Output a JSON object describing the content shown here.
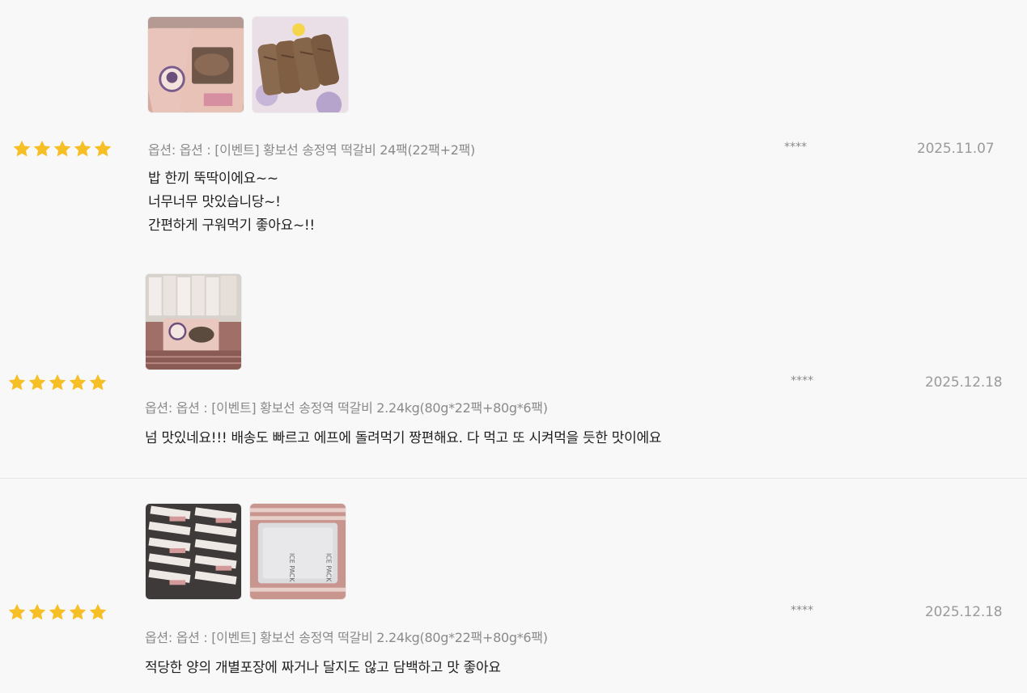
{
  "colors": {
    "star": "#f7bf26",
    "background": "#f8f8f8"
  },
  "reviews": [
    {
      "rating": 5,
      "user": "****",
      "date": "2025.11.07",
      "option": "옵션: 옵션 : [이벤트] 황보선 송정역 떡갈비 24팩(22팩+2팩)",
      "body_lines": [
        "밥 한끼 뚝딱이에요~~",
        "너무너무 맛있습니당~!",
        "간편하게 구워먹기 좋아요~!!"
      ],
      "photos": [
        "package-photo",
        "grilled-galbi-photo"
      ]
    },
    {
      "rating": 5,
      "user": "****",
      "date": "2025.12.18",
      "option": "옵션: 옵션 : [이벤트] 황보선 송정역 떡갈비 2.24kg(80g*22팩+80g*6팩)",
      "body_lines": [
        "넘 맛있네요!!! 배송도 빠르고 에프에 돌려먹기 짱편해요. 다 먹고 또 시켜먹을 듯한 맛이에요"
      ],
      "photos": [
        "box-contents-photo"
      ]
    },
    {
      "rating": 5,
      "user": "****",
      "date": "2025.12.18",
      "option": "옵션: 옵션 : [이벤트] 황보선 송정역 떡갈비 2.24kg(80g*22팩+80g*6팩)",
      "body_lines": [
        "적당한 양의 개별포장에 짜거나 달지도 않고 담백하고 맛 좋아요"
      ],
      "photos": [
        "packs-in-box-photo",
        "ice-pack-photo"
      ],
      "photo_text": {
        "ice_pack": "ICE PACK"
      }
    }
  ]
}
